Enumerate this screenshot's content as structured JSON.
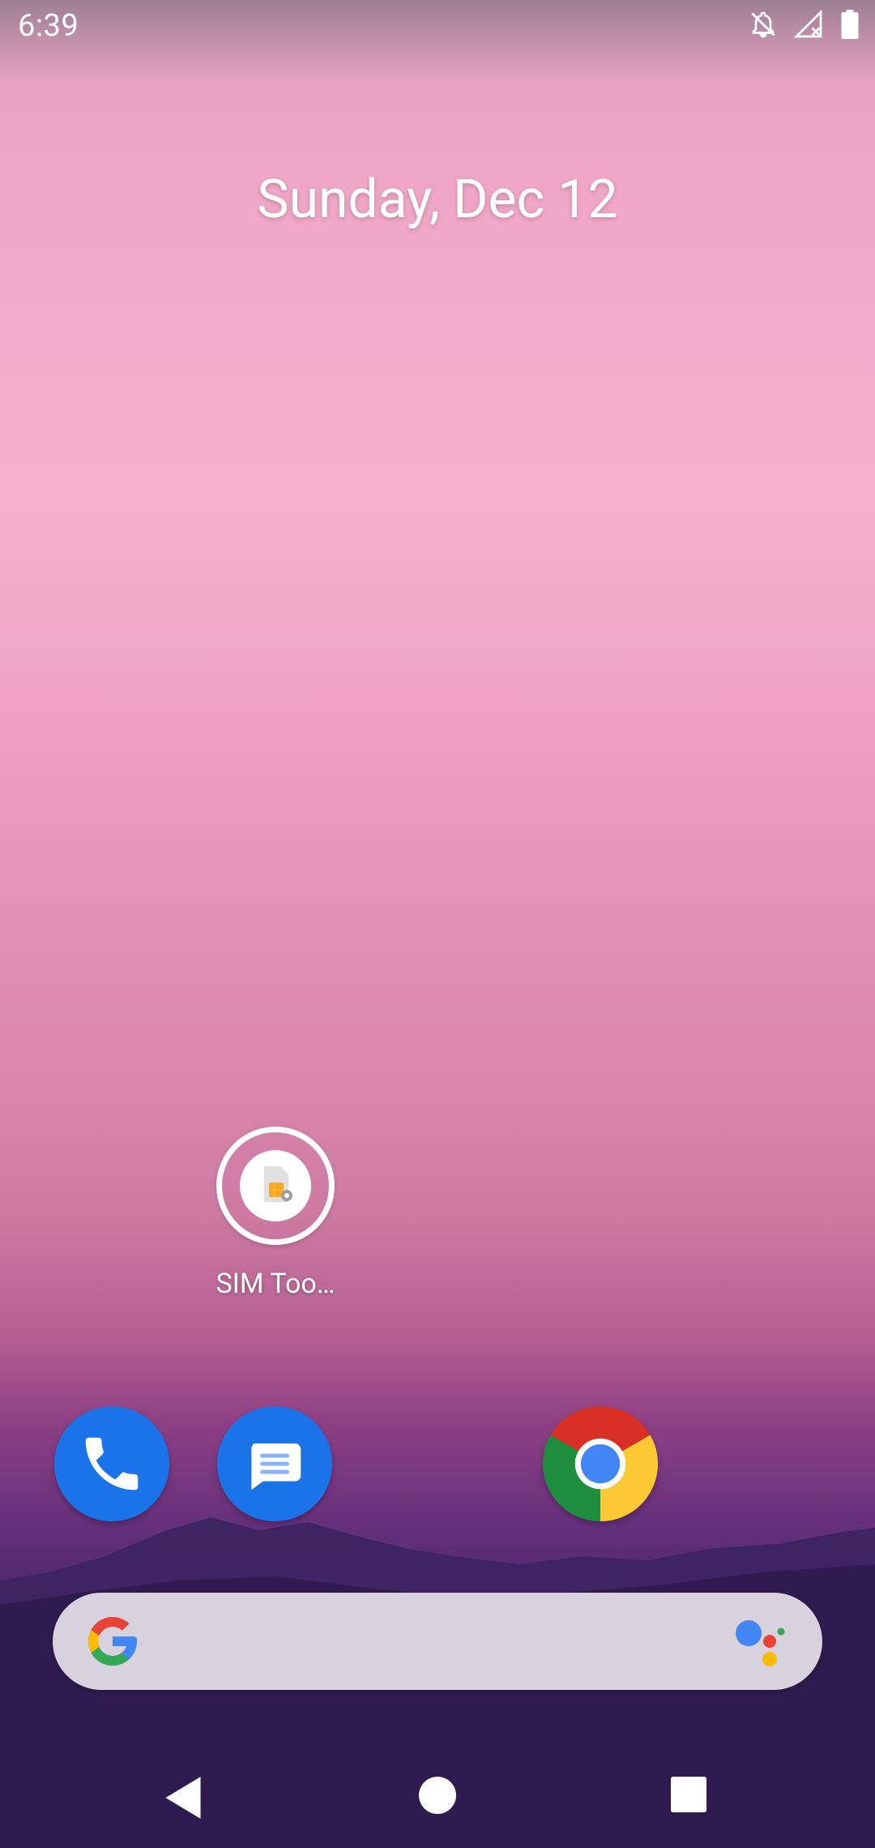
{
  "status_bar": {
    "time": "6:39",
    "icons": [
      "notifications-off-icon",
      "no-signal-icon",
      "battery-full-icon"
    ]
  },
  "home": {
    "date": "Sunday, Dec 12",
    "apps": [
      {
        "label": "SIM Too…",
        "icon": "sim-toolkit-icon"
      }
    ],
    "dock": [
      {
        "icon": "phone-icon",
        "color": "#1a73e8"
      },
      {
        "icon": "messages-icon",
        "color": "#1a73e8"
      },
      {
        "icon": "chrome-icon"
      }
    ]
  },
  "search": {
    "icons": [
      "google-g-icon",
      "google-assistant-icon"
    ]
  },
  "nav": {
    "icons": [
      "back-icon",
      "home-icon",
      "recents-icon"
    ]
  }
}
